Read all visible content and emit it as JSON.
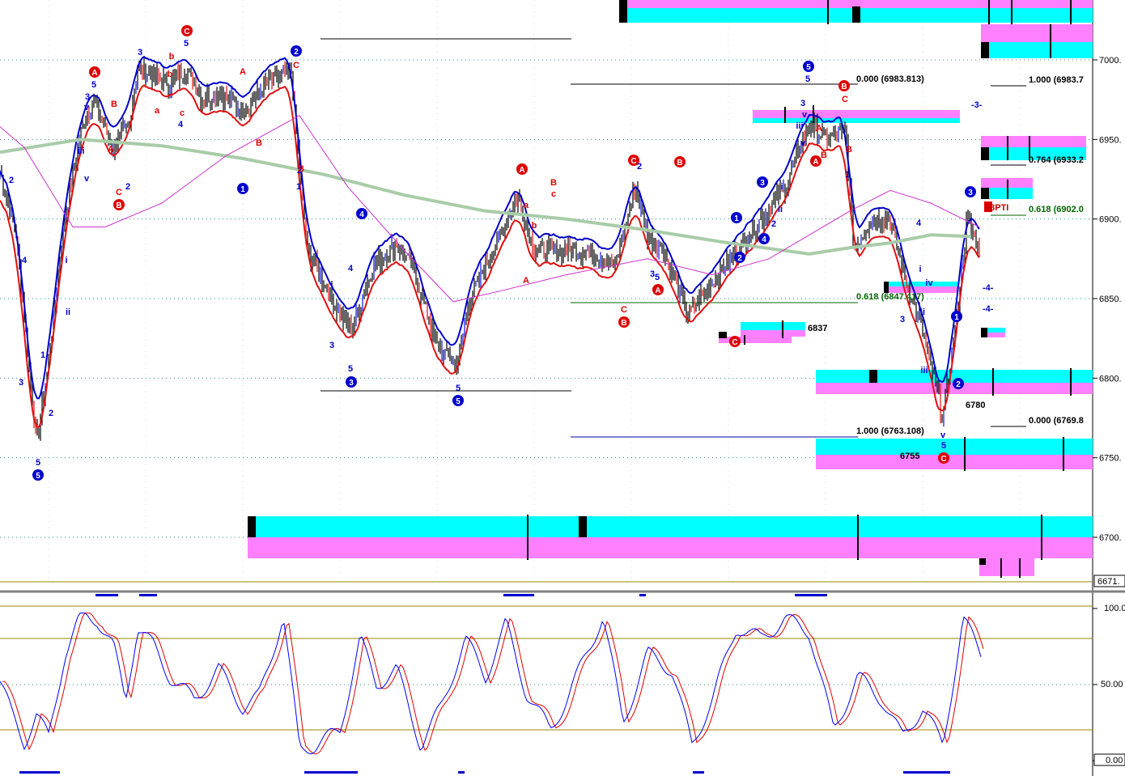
{
  "colors": {
    "price_bar": "#000000",
    "price_bar_up": "#1010e0",
    "price_bar_down": "#e01010",
    "upper_band": "#0000cc",
    "lower_band": "#e01010",
    "ma_long": "#a8cca8",
    "ma_mid": "#cc33cc",
    "cyan": "#00ffff",
    "magenta": "#ff80ff",
    "fib_green": "#006600",
    "stoch_k": "#0000ff",
    "stoch_d": "#e00000",
    "ref_line": "#9a8a00",
    "label_blue": "#0000cc",
    "label_red": "#dd0000"
  },
  "chart_data": [
    {
      "type": "line",
      "panel": "price",
      "title": "",
      "xlabel": "",
      "ylabel": "",
      "y_ticks": [
        "7000.",
        "6950.",
        "6900.",
        "6850.",
        "6800.",
        "6750.",
        "6700."
      ],
      "ylim": [
        6671,
        7034
      ],
      "last_value_label": "6671.",
      "x_count": 1210,
      "series": [
        {
          "key": "price_close",
          "x": [
            0,
            20,
            45,
            60,
            80,
            100,
            115,
            140,
            160,
            170,
            190,
            210,
            230,
            250,
            270,
            300,
            330,
            360,
            370,
            380,
            400,
            420,
            435,
            460,
            490,
            510,
            540,
            565,
            580,
            600,
            640,
            660,
            700,
            730,
            760,
            785,
            800,
            820,
            850,
            880,
            910,
            940,
            970,
            1000,
            1020,
            1045,
            1055,
            1075,
            1100,
            1120,
            1140,
            1165,
            1180,
            1195,
            1210
          ],
          "y": [
            6930,
            6890,
            6760,
            6810,
            6900,
            6955,
            6975,
            6945,
            6960,
            6995,
            6990,
            6985,
            6995,
            6975,
            6980,
            6968,
            6985,
            6992,
            6930,
            6880,
            6860,
            6840,
            6830,
            6870,
            6885,
            6870,
            6820,
            6808,
            6850,
            6870,
            6915,
            6880,
            6880,
            6880,
            6870,
            6920,
            6890,
            6880,
            6840,
            6860,
            6880,
            6900,
            6920,
            6960,
            6950,
            6955,
            6880,
            6900,
            6900,
            6860,
            6830,
            6775,
            6830,
            6900,
            6880
          ]
        },
        {
          "key": "ma_long",
          "x": [
            0,
            100,
            200,
            300,
            400,
            500,
            600,
            700,
            800,
            900,
            1000,
            1050,
            1100,
            1150,
            1200
          ],
          "y": [
            6942,
            6950,
            6946,
            6938,
            6928,
            6915,
            6905,
            6900,
            6893,
            6885,
            6878,
            6882,
            6885,
            6890,
            6889
          ]
        },
        {
          "key": "ma_mid",
          "x": [
            0,
            30,
            60,
            90,
            130,
            200,
            280,
            370,
            430,
            500,
            560,
            620,
            700,
            800,
            880,
            950,
            1000,
            1050,
            1100,
            1150,
            1210
          ],
          "y": [
            6958,
            6945,
            6920,
            6895,
            6895,
            6910,
            6940,
            6965,
            6920,
            6880,
            6848,
            6855,
            6865,
            6875,
            6865,
            6875,
            6890,
            6905,
            6918,
            6910,
            6895
          ]
        }
      ],
      "annotations": {
        "fib_labels": [
          "0.000 (6983.813)",
          "1.000 (6763.108)",
          "0.618 (6847.417)",
          "1.000 (6983.7",
          "0.764 (6933.2",
          "0.618 (6902.0",
          "0.000 (6769.8"
        ],
        "price_labels": [
          "6837",
          "6780",
          "6755"
        ],
        "other_labels": [
          "58PTI",
          "-3-",
          "-4-",
          "-4-"
        ],
        "wave_labels_blue": [
          "1",
          "2",
          "3",
          "4",
          "5",
          "i",
          "ii",
          "iii",
          "iv",
          "v"
        ],
        "wave_labels_red": [
          "A",
          "B",
          "C",
          "a",
          "b",
          "c"
        ]
      }
    },
    {
      "type": "line",
      "panel": "stochastic",
      "y_ticks": [
        "100.0",
        "50.00",
        "0.00"
      ],
      "ylim": [
        0,
        100
      ],
      "series": [
        {
          "key": "stoch_k",
          "x": [
            0,
            15,
            30,
            45,
            60,
            80,
            100,
            120,
            140,
            155,
            170,
            190,
            210,
            240,
            270,
            300,
            320,
            350,
            370,
            390,
            420,
            445,
            465,
            490,
            520,
            545,
            575,
            600,
            625,
            650,
            680,
            700,
            745,
            770,
            800,
            830,
            855,
            880,
            910,
            940,
            970,
            1000,
            1030,
            1060,
            1090,
            1115,
            1140,
            1165,
            1190,
            1212
          ],
          "y": [
            52,
            30,
            12,
            30,
            15,
            70,
            95,
            93,
            75,
            40,
            88,
            75,
            55,
            40,
            60,
            35,
            42,
            95,
            8,
            10,
            20,
            80,
            50,
            60,
            10,
            35,
            80,
            55,
            90,
            45,
            20,
            40,
            95,
            25,
            70,
            60,
            10,
            40,
            88,
            80,
            93,
            85,
            20,
            55,
            40,
            15,
            35,
            10,
            93,
            70
          ]
        }
      ]
    }
  ]
}
